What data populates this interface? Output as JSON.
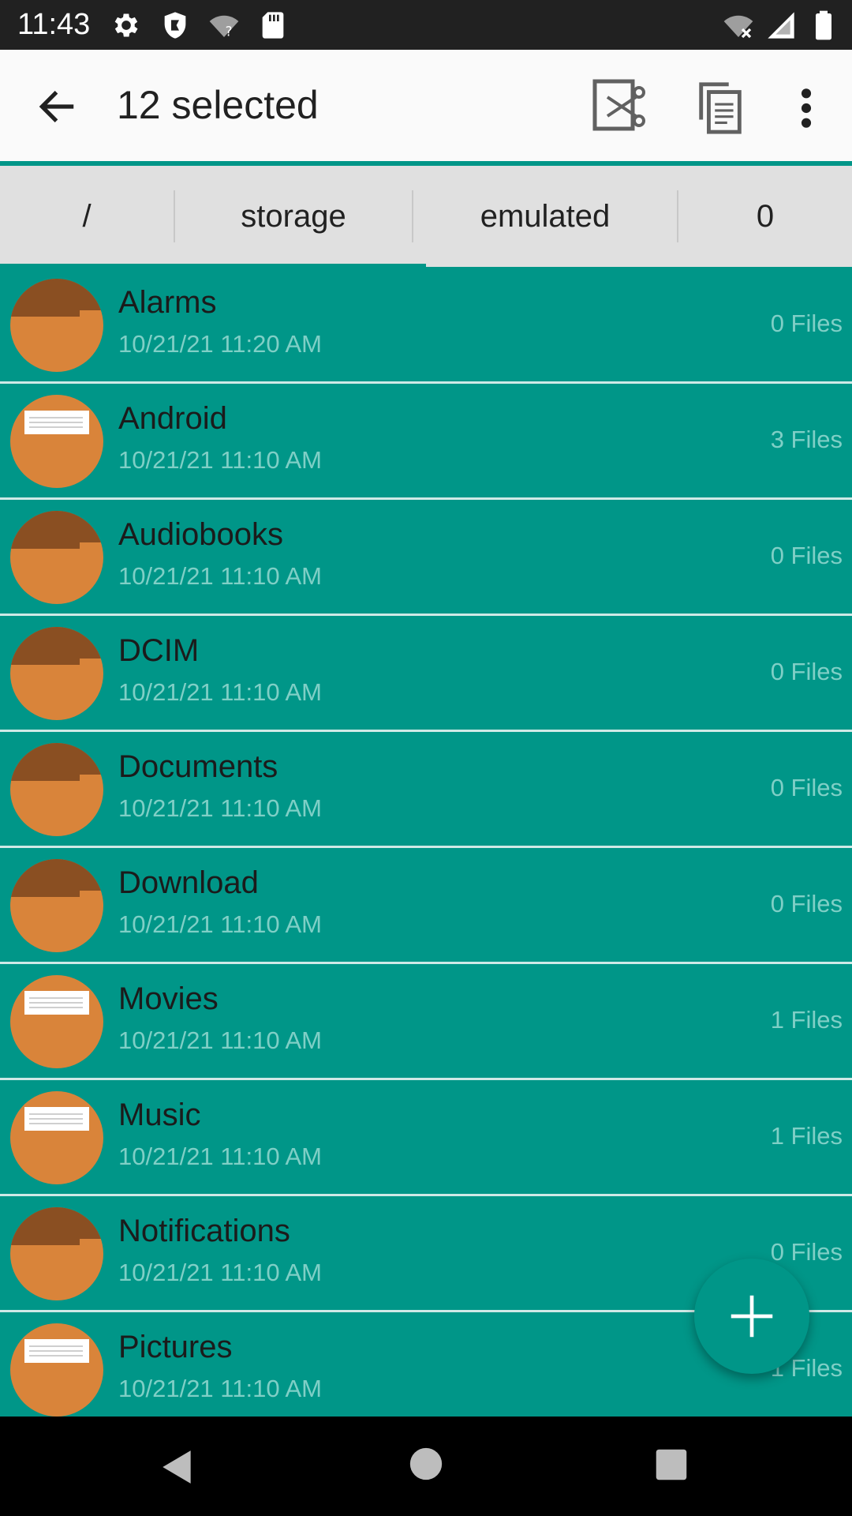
{
  "status_bar": {
    "time": "11:43",
    "left_icons": [
      "settings-icon",
      "shield-icon",
      "wifi-question-icon",
      "sd-card-icon"
    ],
    "right_icons": [
      "wifi-off-icon",
      "cell-signal-icon",
      "battery-icon"
    ]
  },
  "app_bar": {
    "title": "12 selected",
    "back_icon": "arrow-back-icon",
    "actions": [
      "cut-icon",
      "copy-icon",
      "more-vert-icon"
    ]
  },
  "breadcrumb": [
    "/",
    "storage",
    "emulated",
    "0"
  ],
  "files": [
    {
      "name": "Alarms",
      "date": "10/21/21 11:20 AM",
      "count": "0 Files",
      "icon": "empty-folder-icon"
    },
    {
      "name": "Android",
      "date": "10/21/21 11:10 AM",
      "count": "3 Files",
      "icon": "filled-folder-icon"
    },
    {
      "name": "Audiobooks",
      "date": "10/21/21 11:10 AM",
      "count": "0 Files",
      "icon": "empty-folder-icon"
    },
    {
      "name": "DCIM",
      "date": "10/21/21 11:10 AM",
      "count": "0 Files",
      "icon": "empty-folder-icon"
    },
    {
      "name": "Documents",
      "date": "10/21/21 11:10 AM",
      "count": "0 Files",
      "icon": "empty-folder-icon"
    },
    {
      "name": "Download",
      "date": "10/21/21 11:10 AM",
      "count": "0 Files",
      "icon": "empty-folder-icon"
    },
    {
      "name": "Movies",
      "date": "10/21/21 11:10 AM",
      "count": "1 Files",
      "icon": "filled-folder-icon"
    },
    {
      "name": "Music",
      "date": "10/21/21 11:10 AM",
      "count": "1 Files",
      "icon": "filled-folder-icon"
    },
    {
      "name": "Notifications",
      "date": "10/21/21 11:10 AM",
      "count": "0 Files",
      "icon": "empty-folder-icon"
    },
    {
      "name": "Pictures",
      "date": "10/21/21 11:10 AM",
      "count": "1 Files",
      "icon": "filled-folder-icon"
    }
  ],
  "fab": {
    "icon": "add-icon"
  },
  "nav_bar": {
    "icons": [
      "nav-back-icon",
      "nav-home-icon",
      "nav-recents-icon"
    ]
  },
  "colors": {
    "primary": "#009688",
    "folder_orange": "#d9843a",
    "folder_dark": "#8a4f22",
    "secondary_text": "#7fcfc6",
    "appbar_bg": "#fafafa",
    "breadcrumb_bg": "#e0e0e0"
  }
}
